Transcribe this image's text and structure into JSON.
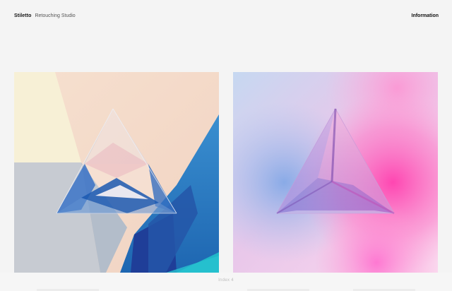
{
  "header": {
    "brand_name": "Stiletto",
    "brand_tagline": "Retouching Studio",
    "info_link": "Information"
  },
  "footer": {
    "index_label": "Index 4"
  },
  "artworks": [
    {
      "style": "geometric glass pyramid",
      "palette": [
        "#f7efd8",
        "#c6cad2",
        "#2b7fc1",
        "#1d3e97",
        "#1fb6c9"
      ]
    },
    {
      "style": "frosted glass pyramid on gradient",
      "palette": [
        "#b9d4ef",
        "#f6a9dc",
        "#ff4fb3",
        "#8b6fd6"
      ]
    }
  ]
}
